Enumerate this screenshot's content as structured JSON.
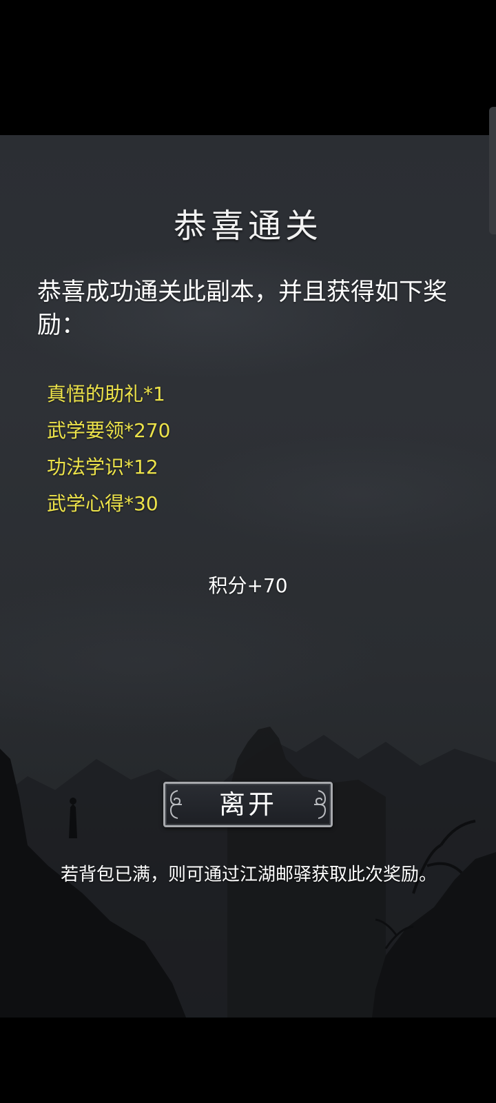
{
  "dialog": {
    "title": "恭喜通关",
    "message": "恭喜成功通关此副本，并且获得如下奖励：",
    "rewards": [
      "真悟的助礼*1",
      "武学要领*270",
      "功法学识*12",
      "武学心得*30"
    ],
    "points": "积分+70",
    "leave_label": "离开",
    "note": "若背包已满，则可通过江湖邮驿获取此次奖励。"
  },
  "colors": {
    "reward_text": "#ede34a",
    "primary_text": "#ffffff",
    "background": "#2b2e33",
    "button_border": "#a7a9ad"
  },
  "icons": {
    "button_ornament": "scroll-curl-icon"
  }
}
